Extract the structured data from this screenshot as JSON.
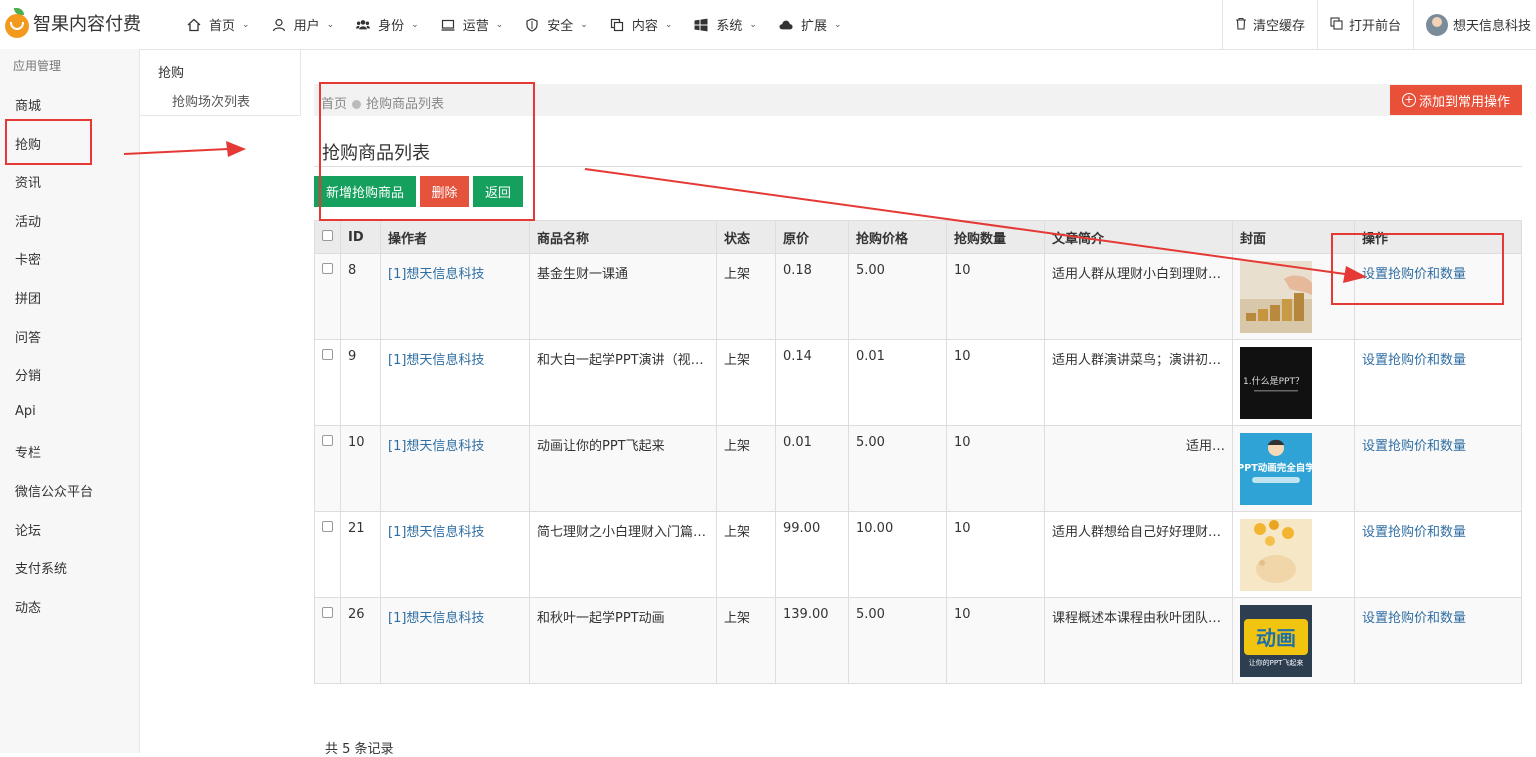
{
  "app": {
    "title": "智果内容付费"
  },
  "nav": [
    {
      "label": "首页",
      "icon": "home-icon"
    },
    {
      "label": "用户",
      "icon": "user-icon"
    },
    {
      "label": "身份",
      "icon": "users-icon"
    },
    {
      "label": "运营",
      "icon": "monitor-icon"
    },
    {
      "label": "安全",
      "icon": "shield-icon"
    },
    {
      "label": "内容",
      "icon": "copy-icon"
    },
    {
      "label": "系统",
      "icon": "windows-icon"
    },
    {
      "label": "扩展",
      "icon": "cloud-icon"
    }
  ],
  "tools": {
    "clear_cache": "清空缓存",
    "open_front": "打开前台",
    "user_name": "想天信息科技"
  },
  "sidebar": {
    "title": "应用管理",
    "items": [
      "商城",
      "抢购",
      "资讯",
      "活动",
      "卡密",
      "拼团",
      "问答",
      "分销",
      "Api",
      "专栏",
      "微信公众平台",
      "论坛",
      "支付系统",
      "动态"
    ]
  },
  "subnav": {
    "title": "抢购",
    "item": "抢购场次列表"
  },
  "breadcrumb": {
    "home": "首页",
    "current": "抢购商品列表"
  },
  "add_common": "添加到常用操作",
  "page_title": "抢购商品列表",
  "buttons": {
    "new": "新增抢购商品",
    "delete": "删除",
    "back": "返回"
  },
  "table": {
    "headers": [
      "ID",
      "操作者",
      "商品名称",
      "状态",
      "原价",
      "抢购价格",
      "抢购数量",
      "文章简介",
      "封面",
      "操作"
    ],
    "rows": [
      {
        "id": "8",
        "operator": "[1]想天信息科技",
        "name": "基金生财一课通",
        "status": "上架",
        "price": "0.18",
        "sale_price": "5.00",
        "qty": "10",
        "intro": "适用人群从理财小白到理财…",
        "cover": "coins-cover",
        "action": "设置抢购价和数量"
      },
      {
        "id": "9",
        "operator": "[1]想天信息科技",
        "name": "和大白一起学PPT演讲（视…",
        "status": "上架",
        "price": "0.14",
        "sale_price": "0.01",
        "qty": "10",
        "intro": "适用人群演讲菜鸟；演讲初…",
        "cover": "ppt-dark-cover",
        "action": "设置抢购价和数量"
      },
      {
        "id": "10",
        "operator": "[1]想天信息科技",
        "name": "动画让你的PPT飞起来",
        "status": "上架",
        "price": "0.01",
        "sale_price": "5.00",
        "qty": "10",
        "intro": "适用…",
        "cover": "ppt-blue-cover",
        "action": "设置抢购价和数量"
      },
      {
        "id": "21",
        "operator": "[1]想天信息科技",
        "name": "简七理财之小白理财入门篇…",
        "status": "上架",
        "price": "99.00",
        "sale_price": "10.00",
        "qty": "10",
        "intro": "适用人群想给自己好好理财…",
        "cover": "piggy-cover",
        "action": "设置抢购价和数量"
      },
      {
        "id": "26",
        "operator": "[1]想天信息科技",
        "name": "和秋叶一起学PPT动画",
        "status": "上架",
        "price": "139.00",
        "sale_price": "5.00",
        "qty": "10",
        "intro": "课程概述本课程由秋叶团队…",
        "cover": "animation-cover",
        "action": "设置抢购价和数量"
      }
    ]
  },
  "covers": {
    "ppt_dark_text": "1.什么是PPT？",
    "ppt_blue_text": "PPT动画完全自学",
    "animation_text": "动画",
    "animation_sub": "让你的PPT飞起来"
  },
  "footer": {
    "count_text": "共 5 条记录"
  },
  "colors": {
    "accent_red": "#e8503a",
    "green": "#16a05d",
    "link": "#2f6ea3",
    "annotation": "#e53935"
  }
}
